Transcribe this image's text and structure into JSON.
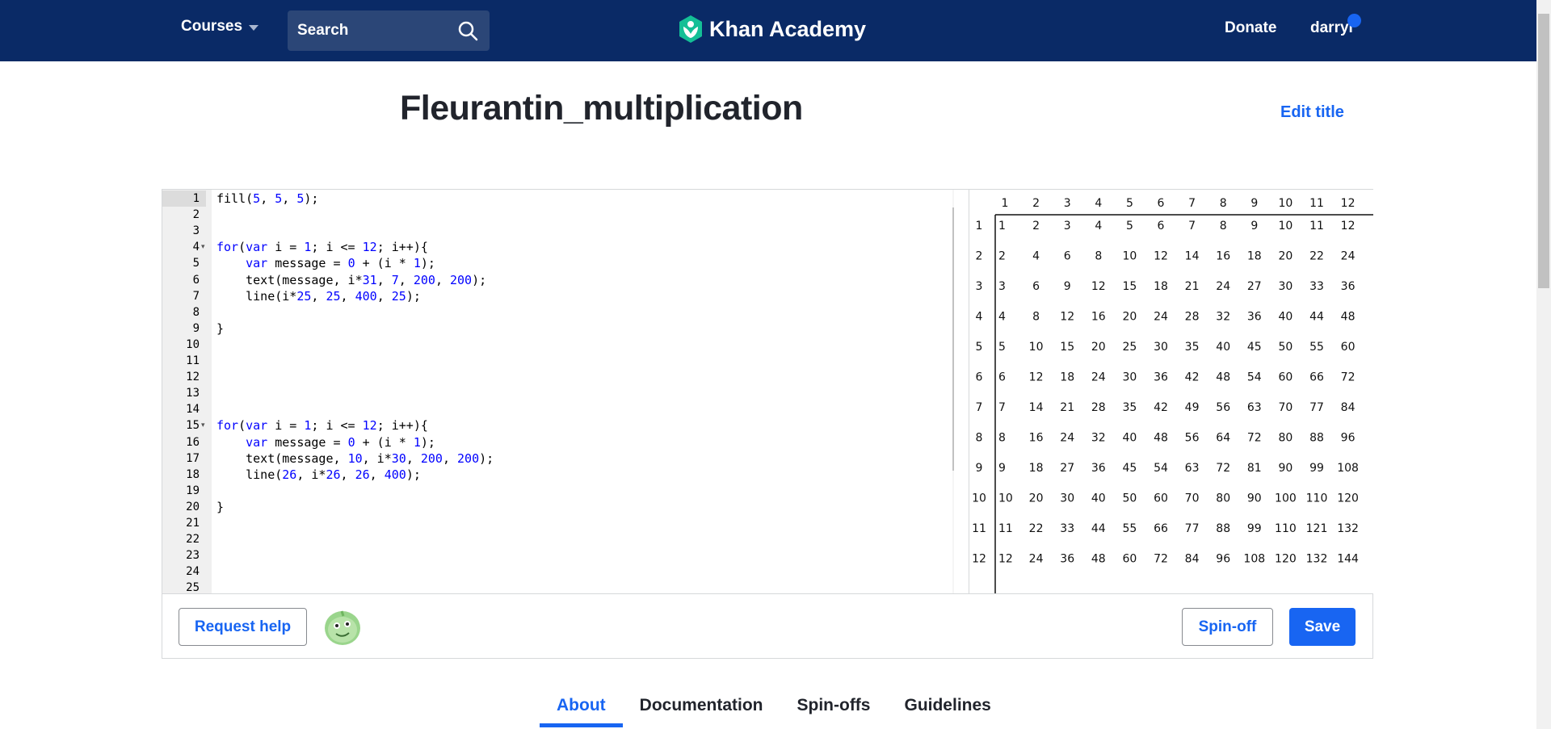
{
  "header": {
    "courses_label": "Courses",
    "search_label": "Search",
    "logo_text": "Khan Academy",
    "donate_label": "Donate",
    "user_name": "darryl"
  },
  "page": {
    "title": "Fleurantin_multiplication",
    "edit_title_label": "Edit title"
  },
  "editor": {
    "lines": [
      "fill(5, 5, 5);",
      "",
      "",
      "for(var i = 1; i <= 12; i++){",
      "    var message = 0 + (i * 1);",
      "    text(message, i*31, 7, 200, 200);",
      "    line(i*25, 25, 400, 25);",
      "",
      "}",
      "",
      "",
      "",
      "",
      "",
      "for(var i = 1; i <= 12; i++){",
      "    var message = 0 + (i * 1);",
      "    text(message, 10, i*30, 200, 200);",
      "    line(26, i*26, 26, 400);",
      "",
      "}",
      "",
      "",
      "",
      "",
      ""
    ],
    "line_numbers": [
      "1",
      "2",
      "3",
      "4",
      "5",
      "6",
      "7",
      "8",
      "9",
      "10",
      "11",
      "12",
      "13",
      "14",
      "15",
      "16",
      "17",
      "18",
      "19",
      "20",
      "21",
      "22",
      "23",
      "24",
      "25"
    ]
  },
  "table": {
    "header": [
      "1",
      "2",
      "3",
      "4",
      "5",
      "6",
      "7",
      "8",
      "9",
      "10",
      "11",
      "12"
    ],
    "rows": [
      [
        "1",
        "1",
        "2",
        "3",
        "4",
        "5",
        "6",
        "7",
        "8",
        "9",
        "10",
        "11",
        "12"
      ],
      [
        "2",
        "2",
        "4",
        "6",
        "8",
        "10",
        "12",
        "14",
        "16",
        "18",
        "20",
        "22",
        "24"
      ],
      [
        "3",
        "3",
        "6",
        "9",
        "12",
        "15",
        "18",
        "21",
        "24",
        "27",
        "30",
        "33",
        "36"
      ],
      [
        "4",
        "4",
        "8",
        "12",
        "16",
        "20",
        "24",
        "28",
        "32",
        "36",
        "40",
        "44",
        "48"
      ],
      [
        "5",
        "5",
        "10",
        "15",
        "20",
        "25",
        "30",
        "35",
        "40",
        "45",
        "50",
        "55",
        "60"
      ],
      [
        "6",
        "6",
        "12",
        "18",
        "24",
        "30",
        "36",
        "42",
        "48",
        "54",
        "60",
        "66",
        "72"
      ],
      [
        "7",
        "7",
        "14",
        "21",
        "28",
        "35",
        "42",
        "49",
        "56",
        "63",
        "70",
        "77",
        "84"
      ],
      [
        "8",
        "8",
        "16",
        "24",
        "32",
        "40",
        "48",
        "56",
        "64",
        "72",
        "80",
        "88",
        "96"
      ],
      [
        "9",
        "9",
        "18",
        "27",
        "36",
        "45",
        "54",
        "63",
        "72",
        "81",
        "90",
        "99",
        "108"
      ],
      [
        "10",
        "10",
        "20",
        "30",
        "40",
        "50",
        "60",
        "70",
        "80",
        "90",
        "100",
        "110",
        "120"
      ],
      [
        "11",
        "11",
        "22",
        "33",
        "44",
        "55",
        "66",
        "77",
        "88",
        "99",
        "110",
        "121",
        "132"
      ],
      [
        "12",
        "12",
        "24",
        "36",
        "48",
        "60",
        "72",
        "84",
        "96",
        "108",
        "120",
        "132",
        "144"
      ]
    ]
  },
  "actions": {
    "request_help": "Request help",
    "spinoff": "Spin-off",
    "save": "Save"
  },
  "tabs": [
    "About",
    "Documentation",
    "Spin-offs",
    "Guidelines"
  ],
  "colors": {
    "header_bg": "#0a2a66",
    "accent": "#1865f2",
    "logo_green": "#14bf96"
  }
}
